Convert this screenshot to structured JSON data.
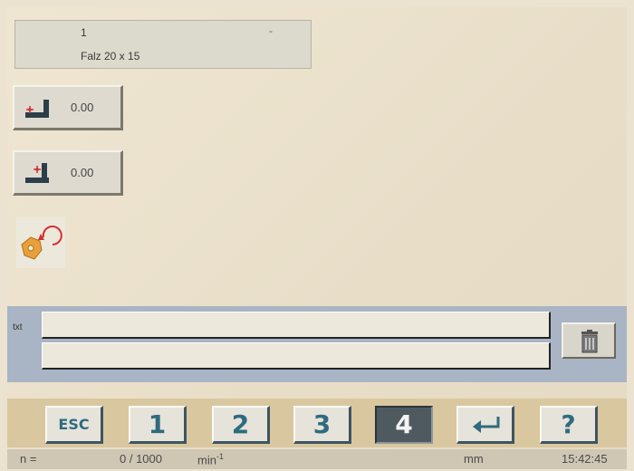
{
  "job": {
    "number": "1",
    "marker": "-",
    "name": "Falz 20 x 15"
  },
  "offsets": [
    {
      "icon": "corner-offset-x-icon",
      "value": "0.00"
    },
    {
      "icon": "corner-offset-y-icon",
      "value": "0.00"
    }
  ],
  "rotate": {
    "icon": "rotate-workpiece-icon"
  },
  "text_area": {
    "label": "txt",
    "line1": "",
    "line2": "",
    "delete_icon": "trash-icon"
  },
  "keypad": {
    "esc": "ESC",
    "keys": [
      "1",
      "2",
      "3",
      "4"
    ],
    "active": "4",
    "enter_icon": "enter-icon",
    "help": "?"
  },
  "status": {
    "speed_label": "n =",
    "speed_value": "0 / 1000",
    "speed_unit": "min",
    "speed_unit_exp": "-1",
    "length_unit": "mm",
    "time": "15:42:45"
  },
  "colors": {
    "background": "#ebe2cf",
    "text_band": "#a9b4c4",
    "key_text": "#2f6b80",
    "active_key": "#4e5a60",
    "bottom_bar": "#d9c7a0"
  }
}
